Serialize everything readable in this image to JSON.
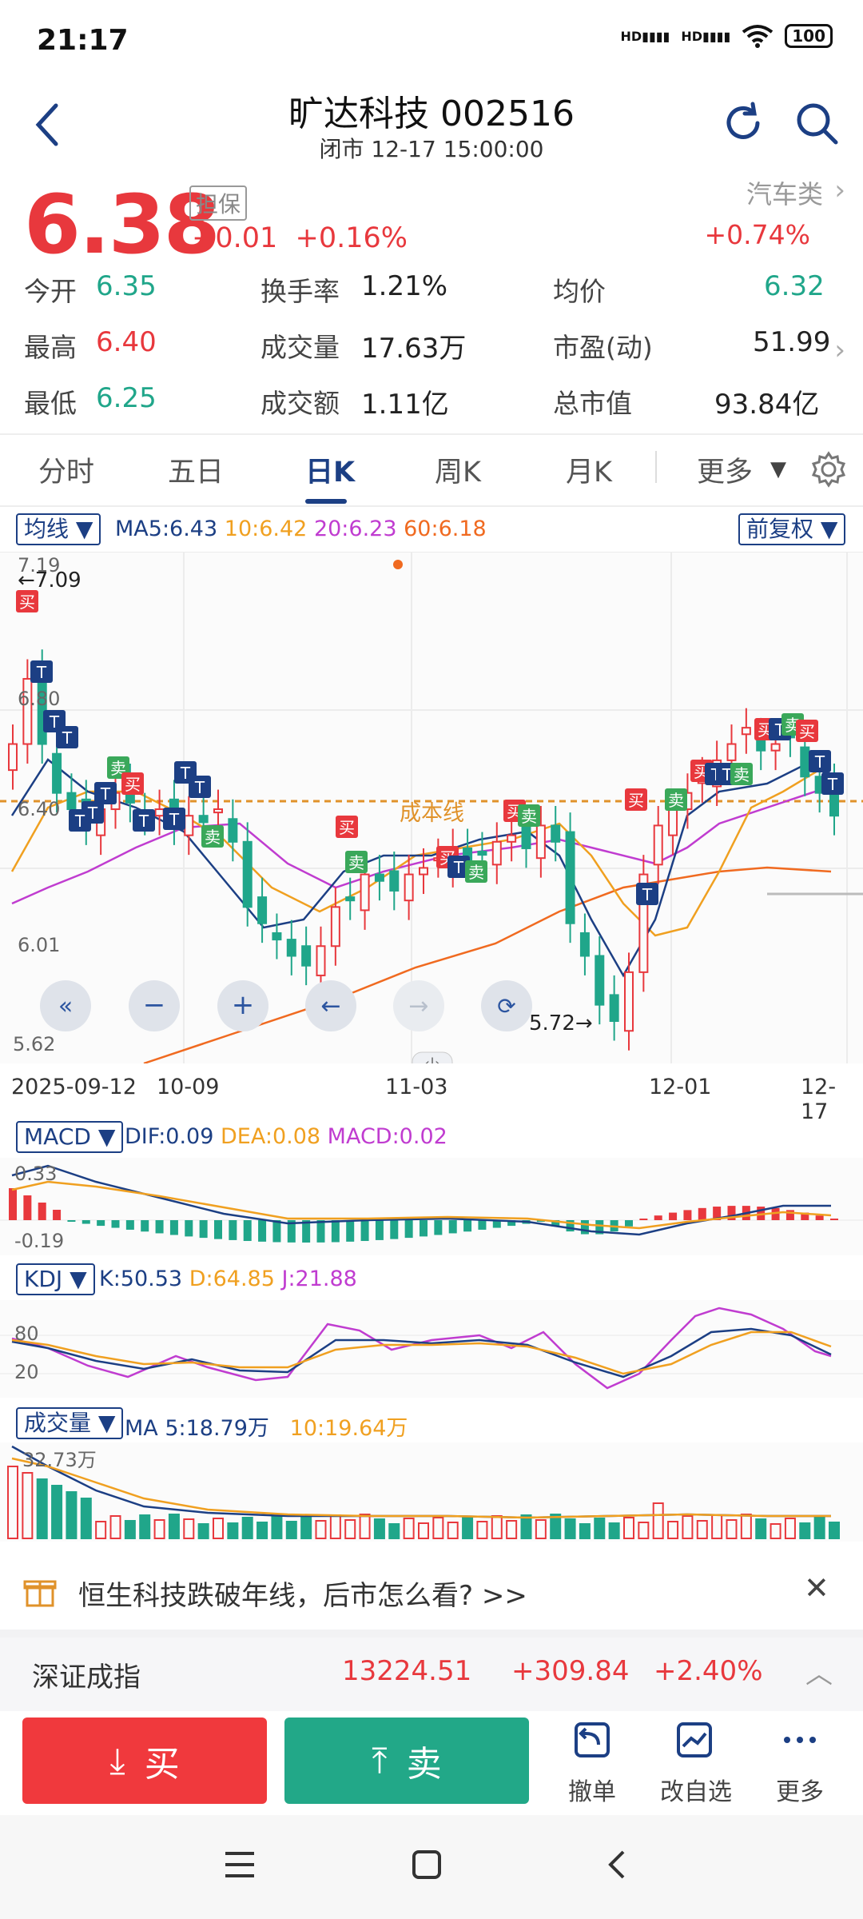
{
  "status_bar": {
    "time": "21:17",
    "battery": "100",
    "net1": "HD",
    "net2": "HD"
  },
  "header": {
    "title": "旷达科技 002516",
    "subtitle": "闭市 12-17 15:00:00"
  },
  "quote": {
    "price": "6.38",
    "tag": "担保",
    "change": "+0.01",
    "change_pct": "+0.16%",
    "sector": "汽车类",
    "sector_change": "+0.74%",
    "stats": [
      {
        "label": "今开",
        "value": "6.35"
      },
      {
        "label": "换手率",
        "value": "1.21%"
      },
      {
        "label": "均价",
        "value": "6.32"
      },
      {
        "label": "最高",
        "value": "6.40"
      },
      {
        "label": "成交量",
        "value": "17.63万"
      },
      {
        "label": "市盈(动)",
        "value": "51.99"
      },
      {
        "label": "最低",
        "value": "6.25"
      },
      {
        "label": "成交额",
        "value": "1.11亿"
      },
      {
        "label": "总市值",
        "value": "93.84亿"
      }
    ]
  },
  "tabs": [
    {
      "label": "分时"
    },
    {
      "label": "五日"
    },
    {
      "label": "日K"
    },
    {
      "label": "周K"
    },
    {
      "label": "月K"
    },
    {
      "label": "更多"
    }
  ],
  "chart": {
    "ma_selector": "均线",
    "ma_legend": {
      "ma5": "MA5:6.43",
      "ma10": "10:6.42",
      "ma20": "20:6.23",
      "ma60": "60:6.18"
    },
    "adjust_selector": "前复权",
    "price_axis": [
      "7.19",
      "6.80",
      "6.40",
      "6.01",
      "5.62"
    ],
    "high_label": "←7.09",
    "low_label": "5.72→",
    "cost_line_label": "成本线",
    "dates": [
      "2025-09-12",
      "10-09",
      "11-03",
      "12-01",
      "12-17"
    ],
    "macd_selector": "MACD",
    "macd_legend": {
      "dif": "DIF:0.09",
      "dea": "DEA:0.08",
      "macd": "MACD:0.02"
    },
    "macd_axis": [
      "0.33",
      "-0.19"
    ],
    "kdj_selector": "KDJ",
    "kdj_legend": {
      "k": "K:50.53",
      "d": "D:64.85",
      "j": "J:21.88"
    },
    "kdj_axis": [
      "80",
      "20"
    ],
    "vol_selector": "成交量",
    "vol_legend": {
      "ma5": "MA 5:18.79万",
      "ma10": "10:19.64万"
    },
    "vol_axis": [
      "32.73万"
    ],
    "signals": {
      "buy": "买",
      "sell": "卖",
      "t": "T"
    }
  },
  "chart_data": {
    "type": "candlestick",
    "ylim": [
      5.62,
      7.19
    ],
    "x_ticks": [
      "2025-09-12",
      "10-09",
      "11-03",
      "12-01",
      "12-17"
    ],
    "close_approx": [
      6.6,
      6.8,
      6.6,
      6.45,
      6.4,
      6.35,
      6.4,
      6.45,
      6.42,
      6.38,
      6.4,
      6.35,
      6.38,
      6.36,
      6.4,
      6.3,
      6.1,
      6.05,
      6.0,
      5.95,
      5.92,
      5.98,
      6.1,
      6.12,
      6.2,
      6.18,
      6.15,
      6.2,
      6.22,
      6.25,
      6.28,
      6.24,
      6.26,
      6.3,
      6.32,
      6.28,
      6.35,
      6.3,
      6.05,
      5.95,
      5.8,
      5.75,
      5.9,
      6.2,
      6.35,
      6.4,
      6.45,
      6.5,
      6.55,
      6.6,
      6.65,
      6.58,
      6.6,
      6.62,
      6.5,
      6.45,
      6.38
    ]
  },
  "banner": {
    "text": "恒生科技跌破年线，后市怎么看? >>"
  },
  "index_bar": {
    "name": "深证成指",
    "value": "13224.51",
    "change": "+309.84",
    "pct": "+2.40%"
  },
  "trade": {
    "buy": "买",
    "sell": "卖",
    "cancel": "撤单",
    "watch": "改自选",
    "more": "更多"
  },
  "colors": {
    "up": "#e8383d",
    "down": "#20a68a",
    "navy": "#1c3f84",
    "ma10": "#f0a020",
    "ma20": "#c03cd0",
    "ma60": "#f06a20"
  }
}
